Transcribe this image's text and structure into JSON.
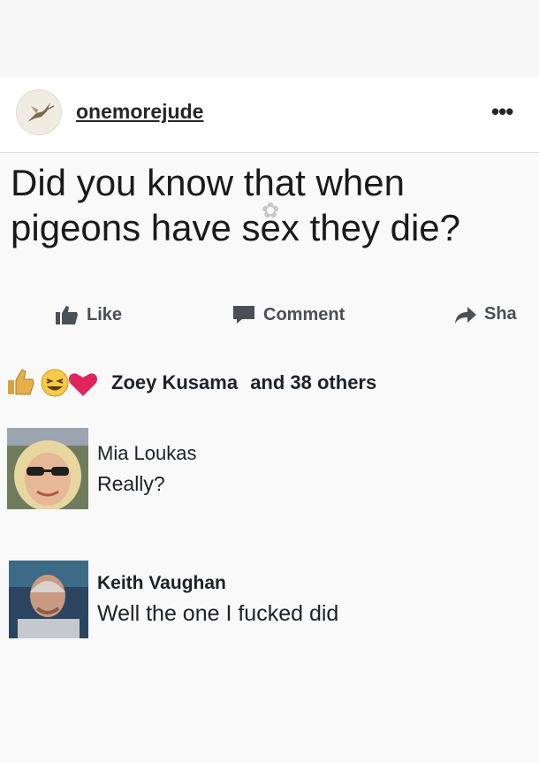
{
  "post": {
    "account": {
      "username": "onemorejude",
      "more_label": "•••"
    },
    "status_line1": "Did you know that when",
    "status_line2": "pigeons have sex they die?",
    "actions": {
      "like": "Like",
      "comment": "Comment",
      "share": "Sha"
    },
    "reactions": {
      "names": "Zoey Kusama",
      "others": "and 38 others"
    },
    "comments": [
      {
        "author": "Mia Loukas",
        "text": "Really?"
      },
      {
        "author": "Keith Vaughan",
        "text": "Well the one I fucked did"
      }
    ]
  },
  "colors": {
    "like_blue": "#4b4f56",
    "love_red": "#e0245e",
    "haha_yellow": "#f7c948"
  }
}
